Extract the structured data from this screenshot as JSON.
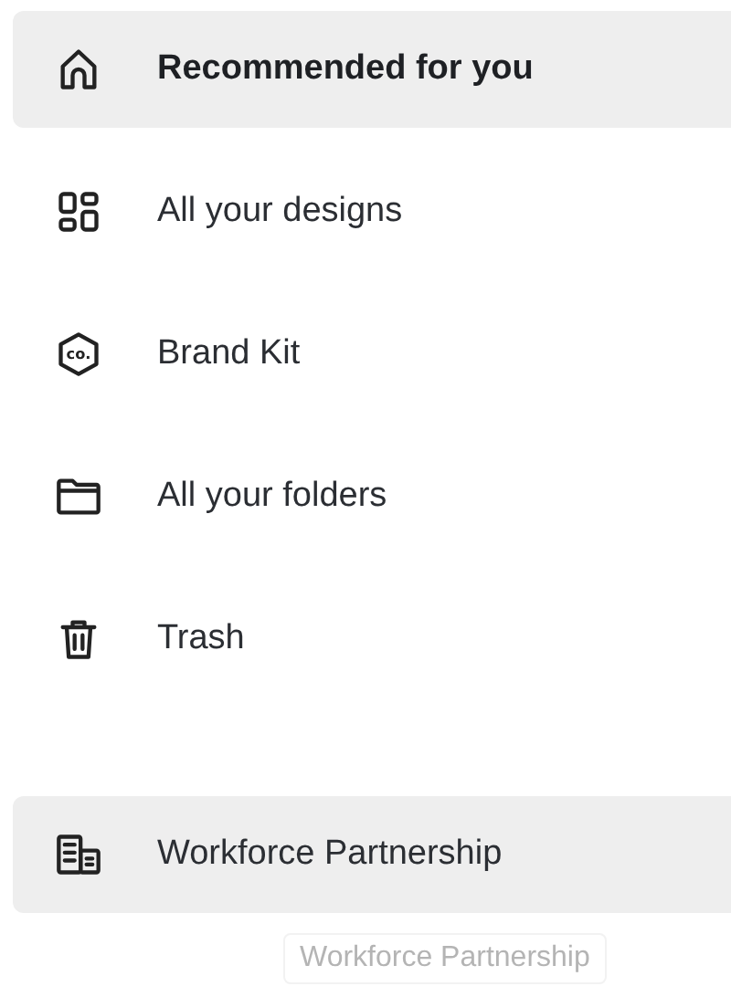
{
  "nav_items": [
    {
      "label": "Recommended for you",
      "kind": "home",
      "selected": true,
      "hovered": false
    },
    {
      "label": "All your designs",
      "kind": "grid",
      "selected": false,
      "hovered": false
    },
    {
      "label": "Brand Kit",
      "kind": "brand",
      "icon_text": "co.",
      "selected": false,
      "hovered": false
    },
    {
      "label": "All your folders",
      "kind": "folder",
      "selected": false,
      "hovered": false
    },
    {
      "label": "Trash",
      "kind": "trash",
      "selected": false,
      "hovered": false
    }
  ],
  "teams": [
    {
      "label": "Workforce Partnership",
      "kind": "building",
      "selected": false,
      "hovered": true
    }
  ],
  "drag_ghost": {
    "label": "Workforce Partnership"
  }
}
